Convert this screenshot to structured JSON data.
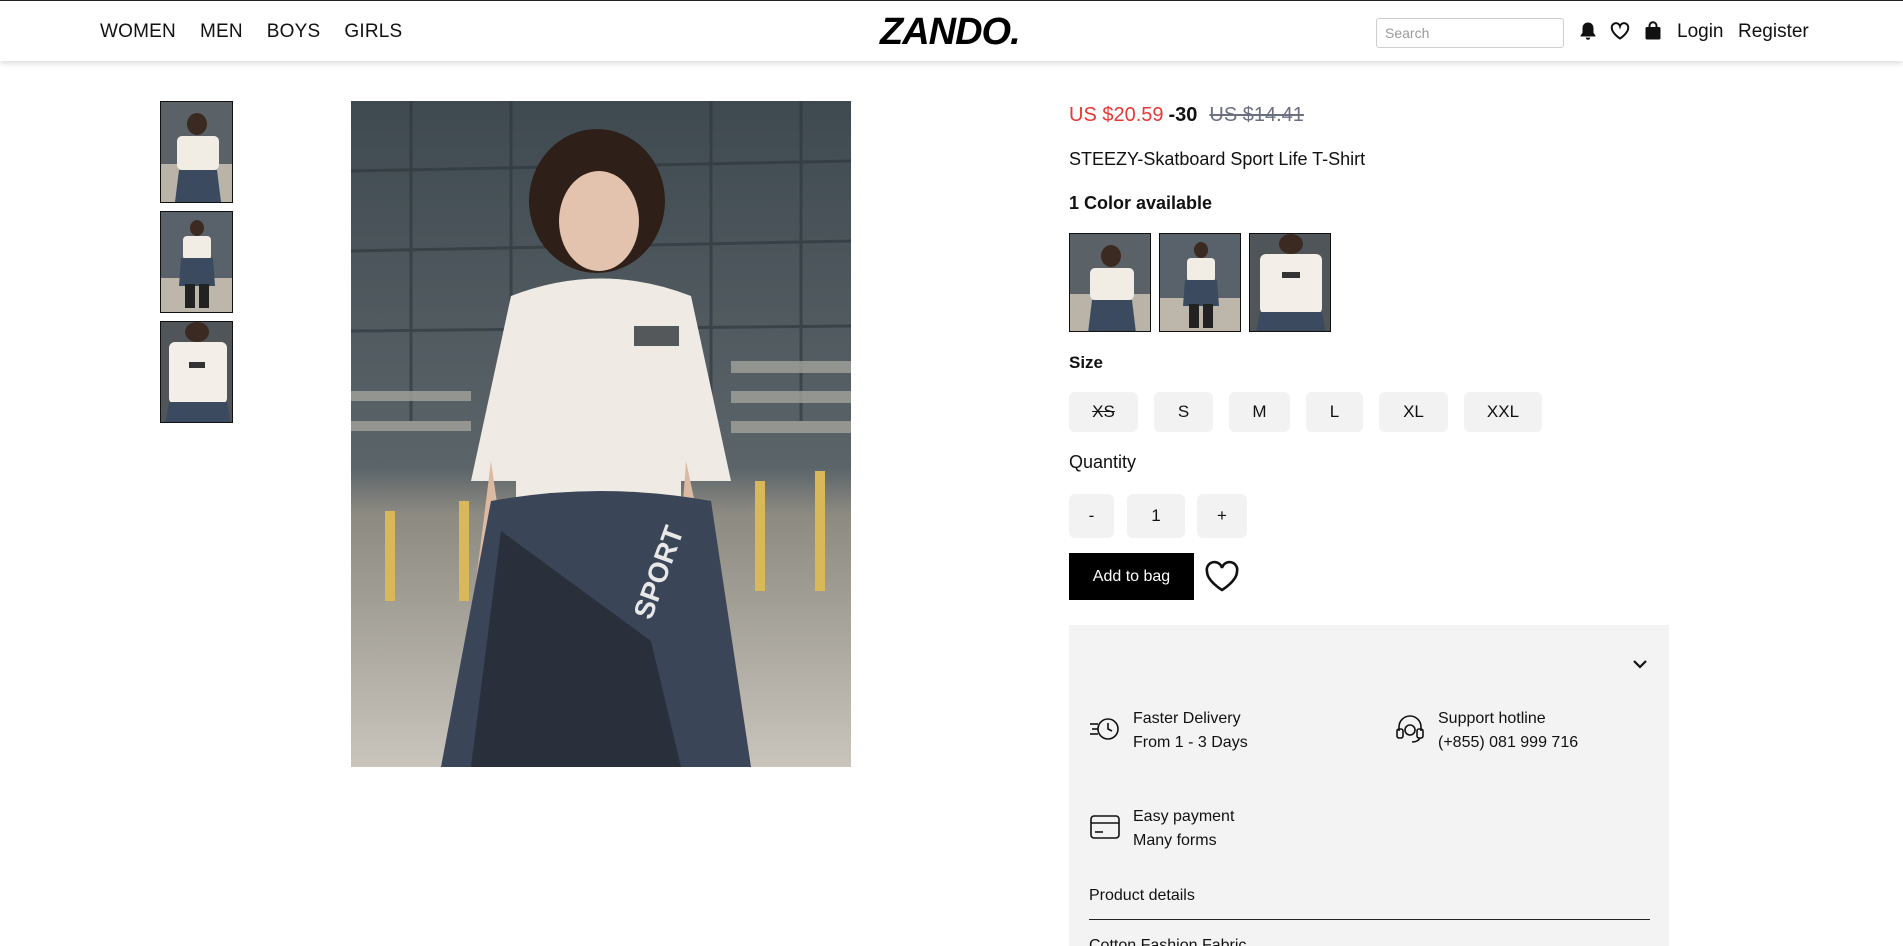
{
  "header": {
    "nav": [
      "WOMEN",
      "MEN",
      "BOYS",
      "GIRLS"
    ],
    "logo_text": "ZANDO.",
    "search_placeholder": "Search",
    "login": "Login",
    "register": "Register"
  },
  "icons": {
    "bell": "bell-icon",
    "heart": "heart-icon",
    "bag": "shopping-bag-icon",
    "delivery": "fast-delivery-icon",
    "support": "headset-icon",
    "payment": "credit-card-icon",
    "expand": "chevron-down-icon"
  },
  "product": {
    "price_sale": "US $20.59",
    "discount": "-30",
    "price_original": "US $14.41",
    "name": "STEEZY-Skatboard Sport Life T-Shirt",
    "color_title": "1 Color available",
    "size_title": "Size",
    "sizes": [
      "XS",
      "S",
      "M",
      "L",
      "XL",
      "XXL"
    ],
    "unavailable_sizes": [
      "XS"
    ],
    "quantity_title": "Quantity",
    "quantity": "1",
    "minus": "-",
    "plus": "+",
    "add_to_bag": "Add to bag"
  },
  "info": {
    "delivery_title": "Faster Delivery",
    "delivery_sub": "From 1 - 3 Days",
    "support_title": "Support hotline",
    "support_sub": "(+855) 081 999 716",
    "payment_title": "Easy payment",
    "payment_sub": "Many forms",
    "details_tab": "Product details",
    "next_line": "Cotton Fashion Fabric"
  },
  "colors": {
    "sale": "#e53935",
    "old_price": "#6b6f80",
    "button": "#000000",
    "chip_bg": "#f2f2f2",
    "panel_bg": "#f3f3f3"
  }
}
